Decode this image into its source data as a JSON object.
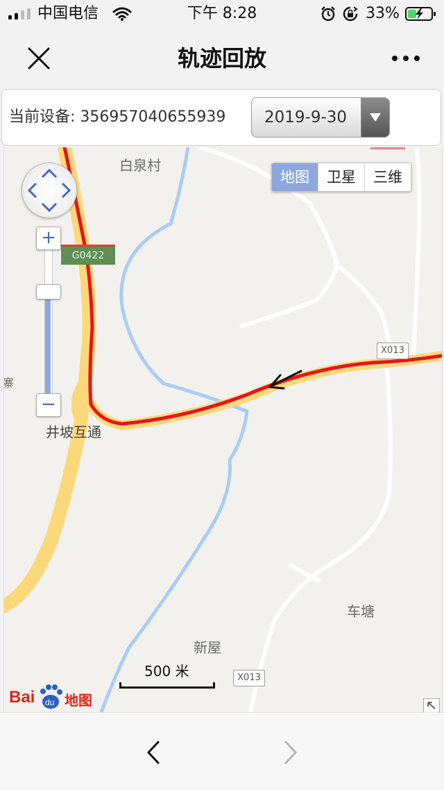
{
  "status_bar": {
    "carrier": "中国电信",
    "time": "下午 8:28",
    "battery_percent": "33%",
    "icons": [
      "signal-icon",
      "wifi-icon",
      "alarm-icon",
      "rotation-lock-icon",
      "battery-charging-icon"
    ]
  },
  "nav": {
    "title": "轨迹回放",
    "close_icon": "close-icon",
    "more_icon": "more-icon"
  },
  "device": {
    "label": "当前设备: 356957040655939",
    "selected_date": "2019-9-30"
  },
  "map": {
    "type_options": [
      "地图",
      "卫星",
      "三维"
    ],
    "active_type": "地图",
    "place_labels": [
      "白泉村",
      "井坡互通",
      "车塘",
      "新屋",
      "寨"
    ],
    "road_shields": [
      "G0422",
      "X013",
      "X013"
    ],
    "scale_label": "500 米",
    "logo": "Bai du 地图",
    "track_color": "#e8141c",
    "highway_color": "#fbd97a",
    "river_color": "#a9cdf2",
    "travel_direction": "westbound"
  },
  "bottom_nav": {
    "back_icon": "chevron-left-icon",
    "forward_icon": "chevron-right-icon"
  }
}
